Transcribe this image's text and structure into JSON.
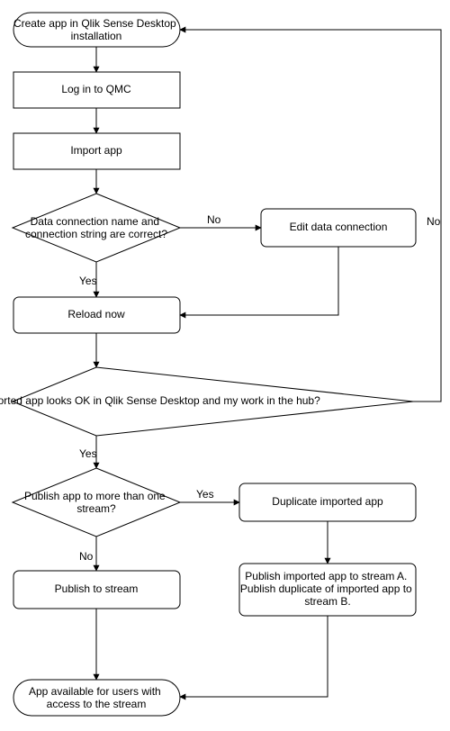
{
  "nodes": {
    "create": {
      "lines": [
        "Create app in Qlik Sense Desktop",
        "installation"
      ]
    },
    "login": {
      "lines": [
        "Log in to QMC"
      ]
    },
    "import": {
      "lines": [
        "Import app"
      ]
    },
    "check_conn": {
      "lines": [
        "Data connection name and",
        "connection string are correct?"
      ]
    },
    "edit_conn": {
      "lines": [
        "Edit data connection"
      ]
    },
    "reload": {
      "lines": [
        "Reload now"
      ]
    },
    "looks_ok": {
      "lines": [
        "The imported app looks OK in Qlik Sense Desktop and my work in the hub?"
      ]
    },
    "more_stream": {
      "lines": [
        "Publish app to more than one",
        "stream?"
      ]
    },
    "duplicate": {
      "lines": [
        "Duplicate imported app"
      ]
    },
    "publish_one": {
      "lines": [
        "Publish to stream"
      ]
    },
    "publish_two": {
      "lines": [
        "Publish imported app to stream A.",
        "Publish duplicate of imported app to",
        "stream B."
      ]
    },
    "available": {
      "lines": [
        "App available for users with",
        "access to the stream"
      ]
    }
  },
  "edges": {
    "yes": "Yes",
    "no": "No"
  }
}
